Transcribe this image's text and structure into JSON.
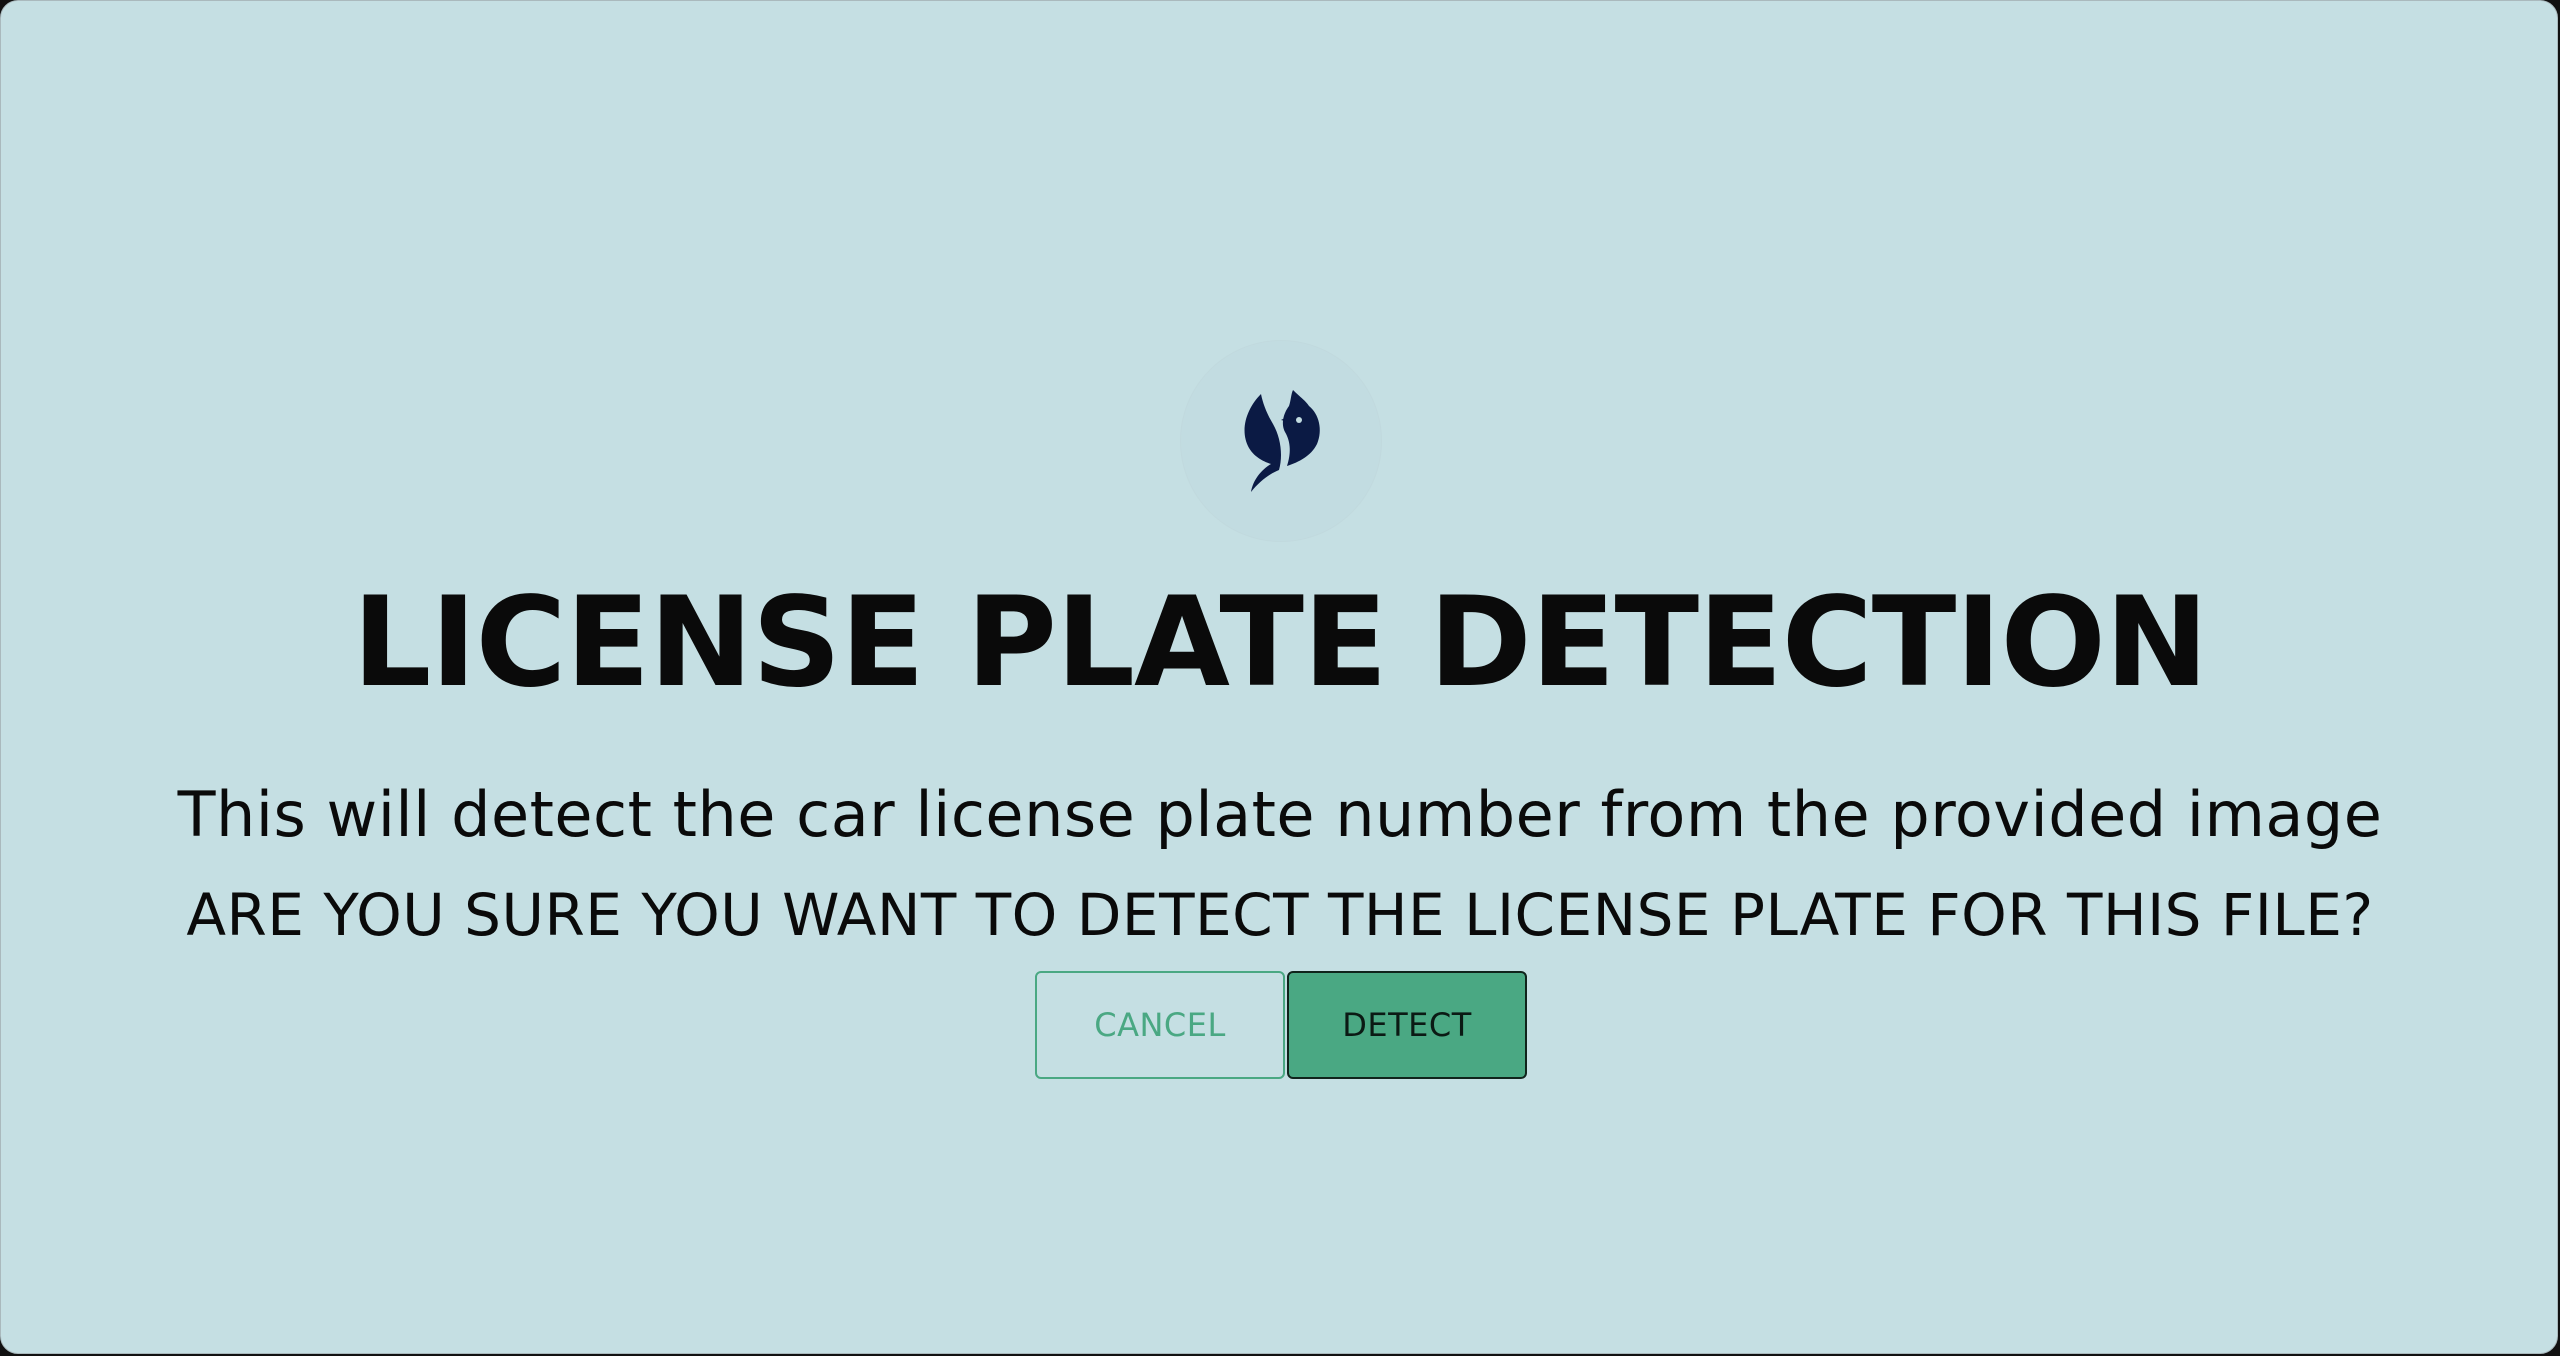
{
  "dialog": {
    "title": "LICENSE PLATE DETECTION",
    "description": "This will detect the car license plate number from the provided image",
    "confirm_question": "ARE YOU SURE YOU WANT TO DETECT THE LICENSE PLATE FOR THIS FILE?",
    "cancel_label": "CANCEL",
    "detect_label": "DETECT",
    "logo_icon": "bird-logo-icon"
  },
  "colors": {
    "background": "#c5dfe3",
    "accent": "#4aa883",
    "logo": "#0b1a44",
    "text": "#0a0a0a"
  }
}
